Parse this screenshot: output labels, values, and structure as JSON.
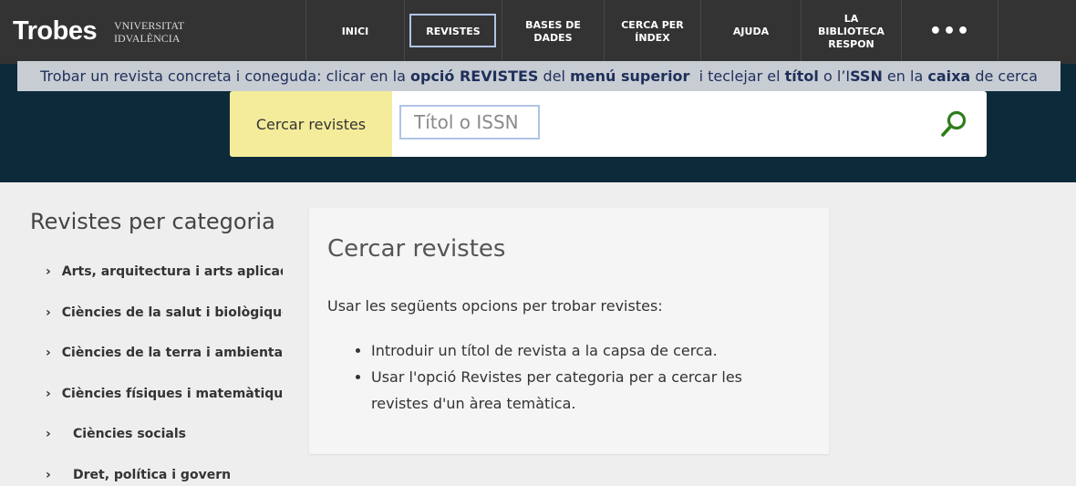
{
  "header": {
    "brand_name": "Trobes",
    "university_line1": "VNIVERSITAT",
    "university_line2": "IDVALÈNCIA",
    "nav": [
      {
        "label": "INICI"
      },
      {
        "label": "REVISTES",
        "selected": true
      },
      {
        "label_line1": "BASES DE",
        "label_line2": "DADES"
      },
      {
        "label_line1": "CERCA PER",
        "label_line2": "ÍNDEX"
      },
      {
        "label": "AJUDA"
      },
      {
        "label_line1": "LA",
        "label_line2": "BIBLIOTECA",
        "label_line3": "RESPON"
      },
      {
        "label": "•••"
      }
    ]
  },
  "callout": {
    "p1": "Trobar un revista concreta i coneguda: clicar en la ",
    "b1": "opció REVISTES",
    "p2": " del ",
    "b2": "menú superior",
    "p3": "  i teclejar el ",
    "b3": "títol",
    "p4": " o l’I",
    "b4": "SSN",
    "p5": " en la ",
    "b5": "caixa",
    "p6": " de cerca"
  },
  "search": {
    "label": "Cercar revistes",
    "placeholder": "Títol o ISSN",
    "button_icon": "search-icon"
  },
  "sidebar": {
    "title": "Revistes per categoria",
    "categories": [
      {
        "label": "Arts, arquitectura i arts aplicades"
      },
      {
        "label": "Ciències de la salut i biològiques"
      },
      {
        "label": "Ciències de la terra i ambientals"
      },
      {
        "label": "Ciències físiques i matemàtiques"
      },
      {
        "label": "Ciències socials"
      },
      {
        "label": "Dret, política i govern"
      }
    ]
  },
  "card": {
    "title": "Cercar revistes",
    "intro": "Usar les següents opcions per trobar revistes:",
    "items": [
      "Introduir un títol de revista a la capsa de cerca.",
      "Usar l'opció Revistes per categoria per a cercar les revistes d'un àrea temàtica."
    ]
  },
  "colors": {
    "topbar": "#333333",
    "hero": "#0c2a3a",
    "search_label_bg": "#f4ec9a",
    "search_icon": "#2e7d1a",
    "callout_bg": "#c8cdd4",
    "highlight_border": "#b0c4e4"
  }
}
